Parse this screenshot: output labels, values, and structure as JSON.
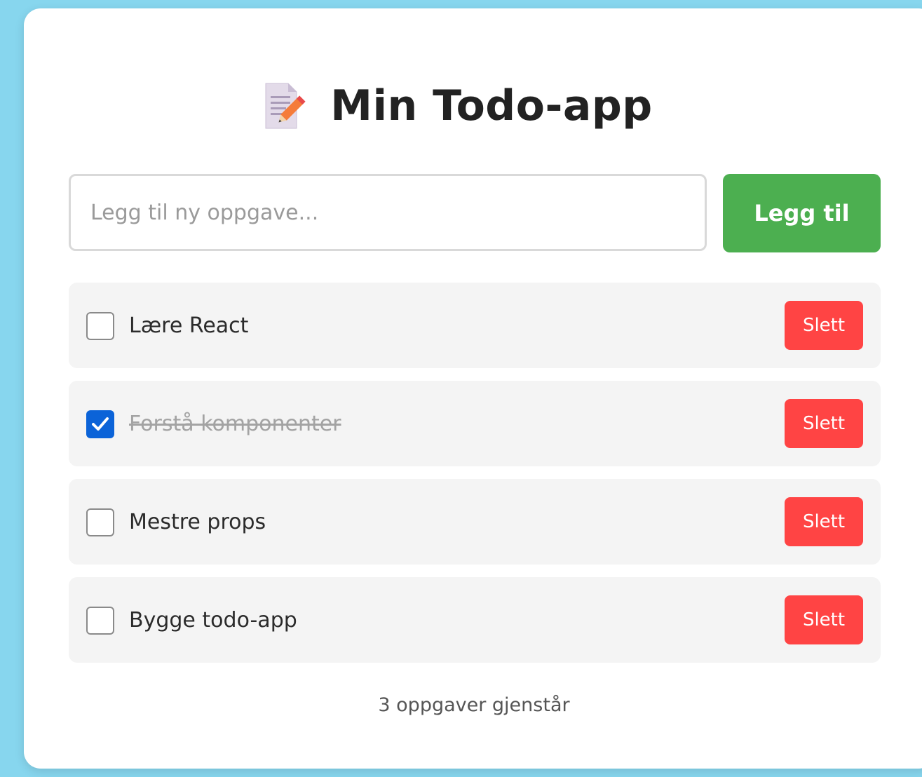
{
  "app": {
    "title": "Min Todo-app",
    "title_icon": "memo-pencil-icon"
  },
  "input": {
    "placeholder": "Legg til ny oppgave...",
    "value": ""
  },
  "add_button": {
    "label": "Legg til",
    "color": "#4caf50"
  },
  "todos": [
    {
      "text": "Lære React",
      "completed": false,
      "delete_label": "Slett"
    },
    {
      "text": "Forstå komponenter",
      "completed": true,
      "delete_label": "Slett"
    },
    {
      "text": "Mestre props",
      "completed": false,
      "delete_label": "Slett"
    },
    {
      "text": "Bygge todo-app",
      "completed": false,
      "delete_label": "Slett"
    }
  ],
  "footer": {
    "remaining_text": "3 oppgaver gjenstår"
  },
  "colors": {
    "background": "#87d6ee",
    "delete": "#ff4444",
    "checkbox_checked": "#0b63d8"
  }
}
